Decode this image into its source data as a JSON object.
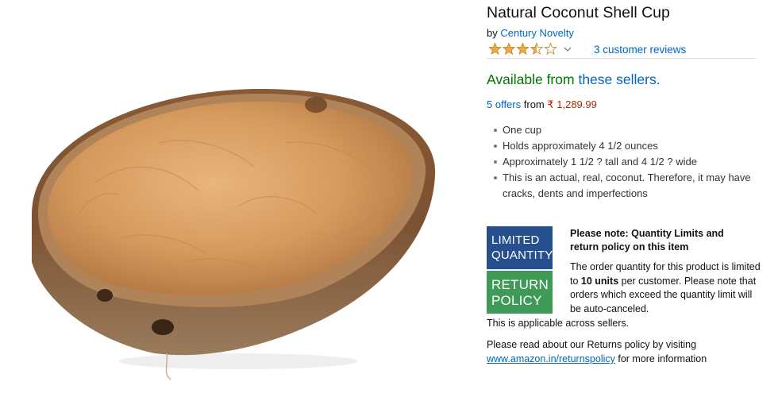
{
  "product": {
    "title": "Natural Coconut Shell Cup",
    "by_prefix": "by",
    "brand": "Century Novelty",
    "rating_value": 3.5,
    "rating_max": 5,
    "reviews_label": "3 customer reviews",
    "image_icon": "coconut-shell-cup-photo"
  },
  "availability": {
    "prefix": "Available from",
    "link": "these sellers."
  },
  "offers": {
    "count_label": "5 offers",
    "from_label": "from",
    "price": "₹ 1,289.99"
  },
  "bullets": [
    "One cup",
    "Holds approximately 4 1/2 ounces",
    "Approximately 1 1/2 ? tall and 4 1/2 ? wide",
    "This is an actual, real, coconut. Therefore, it may have cracks, dents and imperfections"
  ],
  "badges": {
    "limited": [
      "LIMITED",
      "QUANTITY"
    ],
    "return": [
      "RETURN",
      "POLICY"
    ]
  },
  "notice": {
    "heading": "Please note: Quantity Limits and return policy on this item",
    "body_1": "The order quantity for this product is limited to ",
    "units": "10 units",
    "body_2": " per customer. Please note that orders which exceed the quantity limit will be auto-canceled.",
    "tail": "This is applicable across sellers.",
    "returns_text": "Please read about our Returns policy by visiting ",
    "returns_link": "www.amazon.in/returnspolicy",
    "returns_suffix": " for more information"
  },
  "colors": {
    "link": "#0066c0",
    "available_green": "#007600",
    "price_red": "#b12704",
    "star_gold": "#f3a847",
    "badge_blue": "#25508d",
    "badge_green": "#3f9a57"
  }
}
